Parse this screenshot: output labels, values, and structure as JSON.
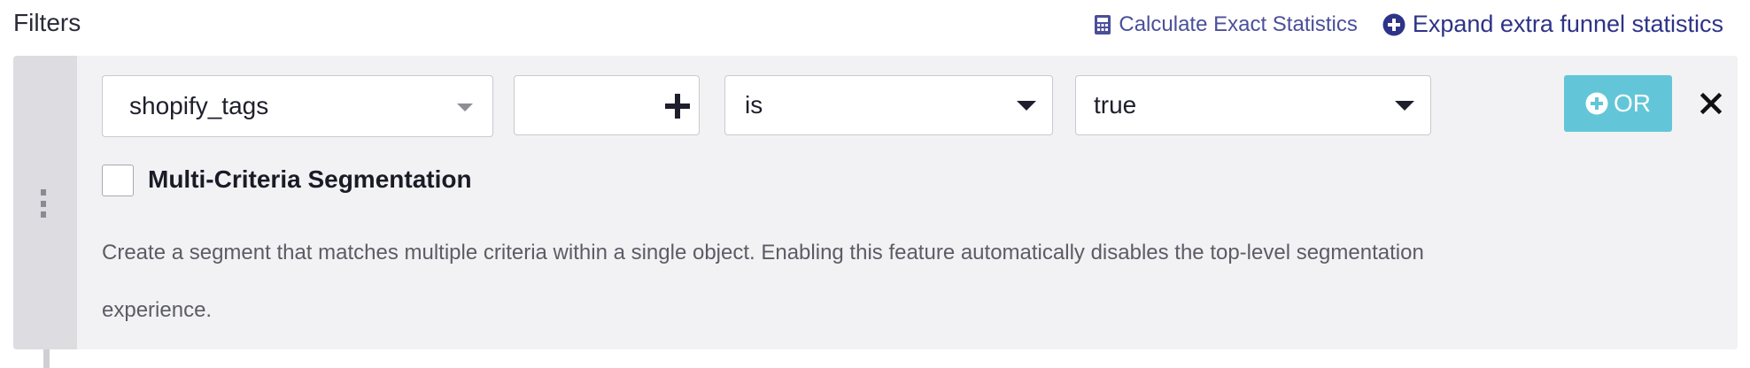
{
  "header": {
    "title": "Filters",
    "calculate_label": "Calculate Exact Statistics",
    "expand_label": "Expand extra funnel statistics"
  },
  "filter": {
    "property": "shopify_tags",
    "value_input": "",
    "operator": "is",
    "value": "true",
    "or_label": "OR"
  },
  "multi_criteria": {
    "checked": false,
    "label": "Multi-Criteria Segmentation",
    "description": "Create a segment that matches multiple criteria within a single object. Enabling this feature automatically disables the top-level segmentation experience."
  },
  "colors": {
    "accent_link": "#2e3388",
    "or_button": "#62c6d8",
    "panel_bg": "#f2f2f4",
    "handle_bg": "#dcdce1"
  },
  "icons": {
    "calculate": "calculator-icon",
    "expand": "plus-circle-icon",
    "add": "plus-icon",
    "remove": "close-icon",
    "drag": "drag-handle-icon"
  }
}
